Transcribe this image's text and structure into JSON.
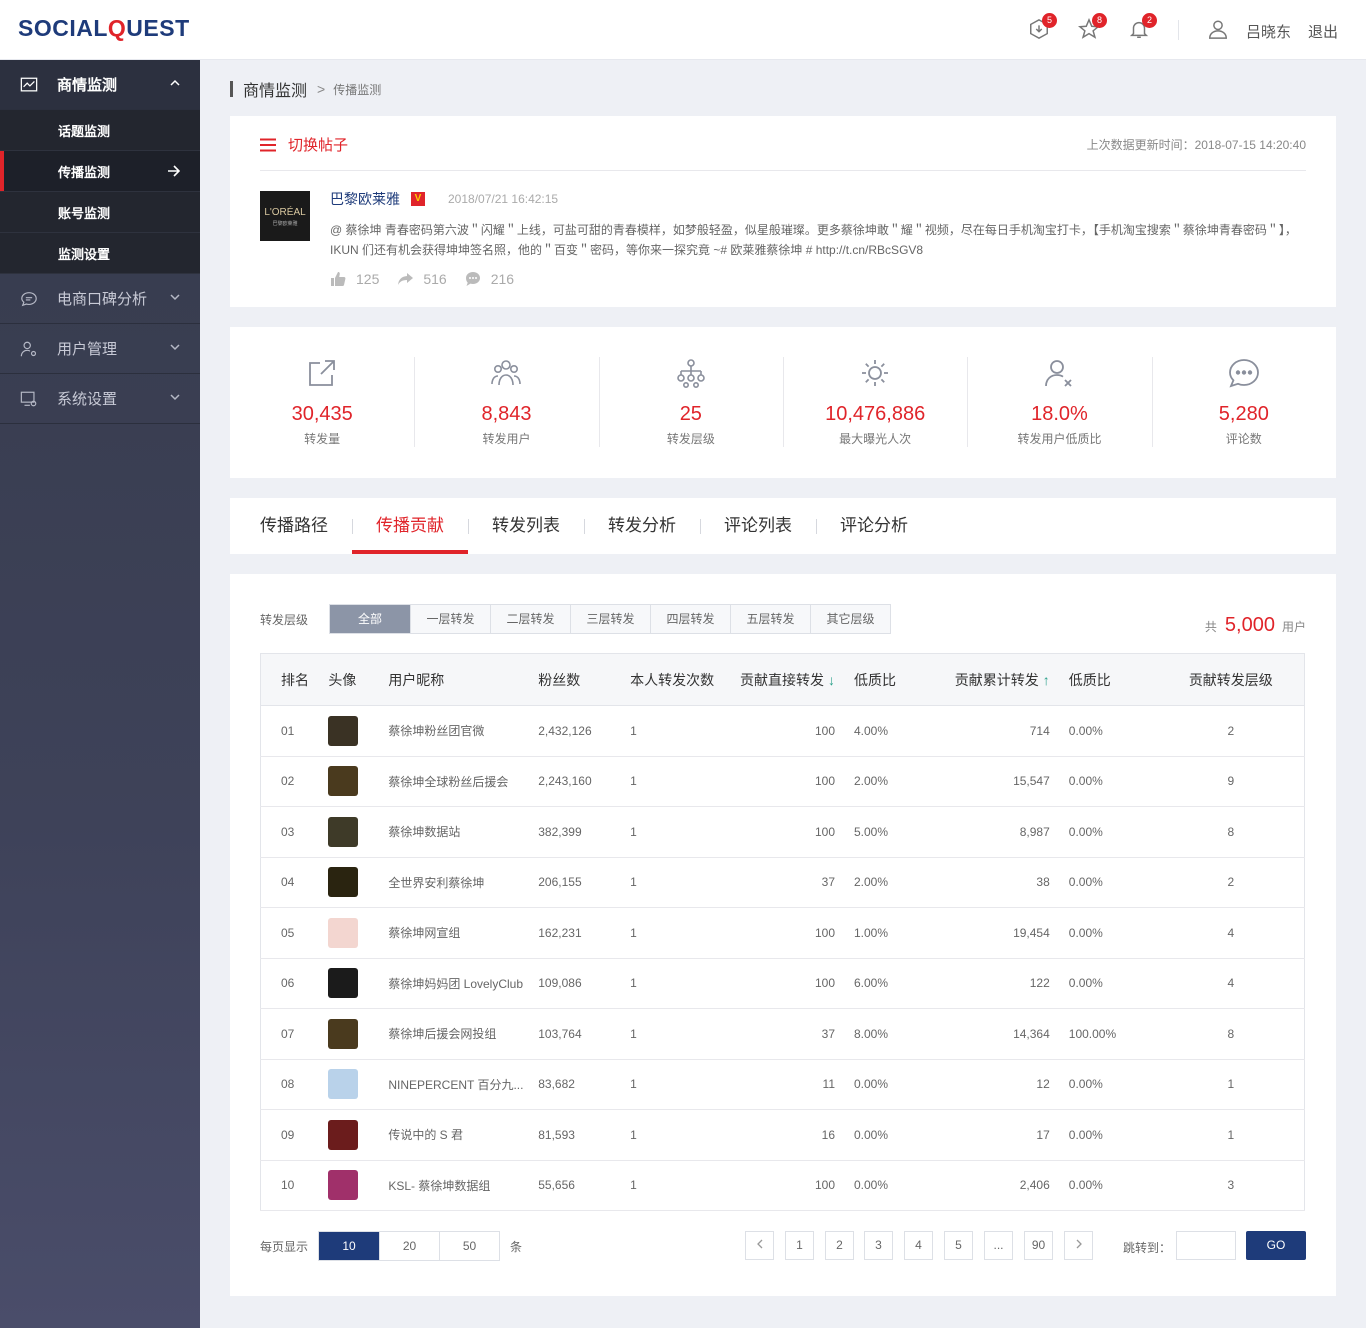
{
  "header": {
    "logo_a": "SOCIAL",
    "logo_q": "Q",
    "logo_b": "UEST",
    "badges": [
      "5",
      "8",
      "2"
    ],
    "user_name": "吕晓东",
    "logout": "退出"
  },
  "sidebar": {
    "main_active": "商情监测",
    "subs": [
      "话题监测",
      "传播监测",
      "账号监测",
      "监测设置"
    ],
    "groups": [
      "电商口碑分析",
      "用户管理",
      "系统设置"
    ]
  },
  "breadcrumb": {
    "level1": "商情监测",
    "sep": ">",
    "level2": "传播监测"
  },
  "post": {
    "switch_label": "切换帖子",
    "update_time": "上次数据更新时间：2018-07-15 14:20:40",
    "avatar_text": "L'ORÉAL",
    "avatar_sub": "巴黎欧莱雅",
    "account": "巴黎欧莱雅",
    "v": "V",
    "date": "2018/07/21 16:42:15",
    "text": "@ 蔡徐坤 青春密码第六波＂闪耀＂上线，可盐可甜的青春模样，如梦般轻盈，似星般璀璨。更多蔡徐坤敢＂耀＂视频，尽在每日手机淘宝打卡，【手机淘宝搜索＂蔡徐坤青春密码＂】，IKUN 们还有机会获得坤坤签名照，他的＂百变＂密码，等你来一探究竟 ~# 欧莱雅蔡徐坤 # http://t.cn/RBcSGV8",
    "likes": "125",
    "reposts": "516",
    "comments": "216"
  },
  "metrics": [
    {
      "icon": "share-icon",
      "value": "30,435",
      "label": "转发量"
    },
    {
      "icon": "users-icon",
      "value": "8,843",
      "label": "转发用户"
    },
    {
      "icon": "hierarchy-icon",
      "value": "25",
      "label": "转发层级"
    },
    {
      "icon": "sun-icon",
      "value": "10,476,886",
      "label": "最大曝光人次"
    },
    {
      "icon": "user-x-icon",
      "value": "18.0%",
      "label": "转发用户低质比"
    },
    {
      "icon": "comment-icon",
      "value": "5,280",
      "label": "评论数"
    }
  ],
  "tabs": [
    "传播路径",
    "传播贡献",
    "转发列表",
    "转发分析",
    "评论列表",
    "评论分析"
  ],
  "filter": {
    "label": "转发层级",
    "options": [
      "全部",
      "一层转发",
      "二层转发",
      "三层转发",
      "四层转发",
      "五层转发",
      "其它层级"
    ],
    "total_prefix": "共",
    "total_value": "5,000",
    "total_suffix": "用户"
  },
  "table": {
    "headers": [
      "排名",
      "头像",
      "用户昵称",
      "粉丝数",
      "本人转发次数",
      "贡献直接转发",
      "低质比",
      "贡献累计转发",
      "低质比",
      "贡献转发层级"
    ],
    "sort_down": "↓",
    "sort_up": "↑",
    "rows": [
      {
        "rank": "01",
        "avatar_color": "#3a3224",
        "name": "蔡徐坤粉丝团官微",
        "fans": "2,432,126",
        "self": "1",
        "direct": "100",
        "lq1": "4.00%",
        "cum": "714",
        "lq2": "0.00%",
        "level": "2"
      },
      {
        "rank": "02",
        "avatar_color": "#4a3a1e",
        "name": "蔡徐坤全球粉丝后援会",
        "fans": "2,243,160",
        "self": "1",
        "direct": "100",
        "lq1": "2.00%",
        "cum": "15,547",
        "lq2": "0.00%",
        "level": "9"
      },
      {
        "rank": "03",
        "avatar_color": "#3e3a28",
        "name": "蔡徐坤数据站",
        "fans": "382,399",
        "self": "1",
        "direct": "100",
        "lq1": "5.00%",
        "cum": "8,987",
        "lq2": "0.00%",
        "level": "8"
      },
      {
        "rank": "04",
        "avatar_color": "#2a2410",
        "name": "全世界安利蔡徐坤",
        "fans": "206,155",
        "self": "1",
        "direct": "37",
        "lq1": "2.00%",
        "cum": "38",
        "lq2": "0.00%",
        "level": "2"
      },
      {
        "rank": "05",
        "avatar_color": "#f3d6d0",
        "name": "蔡徐坤网宣组",
        "fans": "162,231",
        "self": "1",
        "direct": "100",
        "lq1": "1.00%",
        "cum": "19,454",
        "lq2": "0.00%",
        "level": "4"
      },
      {
        "rank": "06",
        "avatar_color": "#1b1b1b",
        "name": "蔡徐坤妈妈团 LovelyClub",
        "fans": "109,086",
        "self": "1",
        "direct": "100",
        "lq1": "6.00%",
        "cum": "122",
        "lq2": "0.00%",
        "level": "4"
      },
      {
        "rank": "07",
        "avatar_color": "#4a3a1e",
        "name": "蔡徐坤后援会网投组",
        "fans": "103,764",
        "self": "1",
        "direct": "37",
        "lq1": "8.00%",
        "cum": "14,364",
        "lq2": "100.00%",
        "level": "8"
      },
      {
        "rank": "08",
        "avatar_color": "#b9d2ea",
        "name": "NINEPERCENT 百分九...",
        "fans": "83,682",
        "self": "1",
        "direct": "11",
        "lq1": "0.00%",
        "cum": "12",
        "lq2": "0.00%",
        "level": "1"
      },
      {
        "rank": "09",
        "avatar_color": "#6b1c1c",
        "name": "传说中的 S 君",
        "fans": "81,593",
        "self": "1",
        "direct": "16",
        "lq1": "0.00%",
        "cum": "17",
        "lq2": "0.00%",
        "level": "1"
      },
      {
        "rank": "10",
        "avatar_color": "#a0306a",
        "name": "KSL- 蔡徐坤数据组",
        "fans": "55,656",
        "self": "1",
        "direct": "100",
        "lq1": "0.00%",
        "cum": "2,406",
        "lq2": "0.00%",
        "level": "3"
      }
    ]
  },
  "pagination": {
    "per_page_label": "每页显示",
    "sizes": [
      "10",
      "20",
      "50"
    ],
    "unit": "条",
    "pages": [
      "1",
      "2",
      "3",
      "4",
      "5",
      "...",
      "90"
    ],
    "jump_label": "跳转到：",
    "go": "GO"
  }
}
